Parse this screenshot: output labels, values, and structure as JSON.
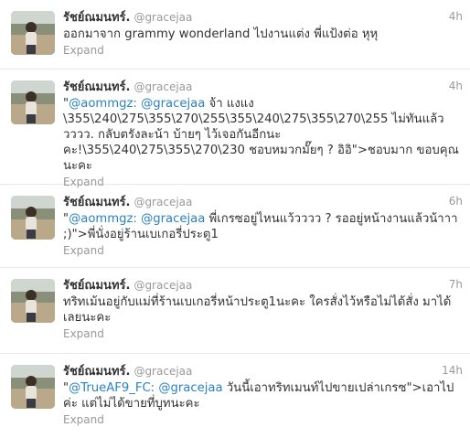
{
  "tweets": [
    {
      "fullname": "รัชย์ณมนทร์.",
      "username": "@gracejaa",
      "time": "4h",
      "mention_1": "",
      "mention_2": "",
      "text": "ออกมาจาก grammy wonderland ไปงานแต่ง พี่แป้งต่อ หุหุ",
      "expand": "Expand"
    },
    {
      "fullname": "รัชย์ณมนทร์.",
      "username": "@gracejaa",
      "time": "4h",
      "quote_open": "\"",
      "mention_1": "@aommgz:",
      "mention_2": "@gracejaa",
      "text": " จ้า แงแง \\355\\240\\275\\355\\270\\255\\355\\240\\275\\355\\270\\255 ไม่ทันแล้ววววว. กลับตรังละน้า บ้ายๆ ไว้เจอกันอีกนะคะ!\\355\\240\\275\\355\\270\\230 ชอบหมวกมั๊ยๆ ? อิอิ\">ชอบมาก ขอบคุณนะคะ",
      "expand": "Expand"
    },
    {
      "fullname": "รัชย์ณมนทร์.",
      "username": "@gracejaa",
      "time": "6h",
      "quote_open": "\"",
      "mention_1": "@aommgz:",
      "mention_2": "@gracejaa",
      "text": " พี่เกรซอยู่ไหนแว้วววว ? รออยู่หน้างานแล้วน้าาา ;)\">พี่นั่งอยู่ร้านเบเกอรี่ประตู1",
      "expand": "Expand"
    },
    {
      "fullname": "รัชย์ณมนทร์.",
      "username": "@gracejaa",
      "time": "7h",
      "mention_1": "",
      "mention_2": "",
      "text": "ทริทเม้นอยู่กับแม่ที่ร้านเบเกอรี่หน้าประตู1นะคะ ใครสั่งไว้หรือไม่ได้สั่ง มาได้เลยนะคะ",
      "expand": "Expand"
    },
    {
      "fullname": "รัชย์ณมนทร์.",
      "username": "@gracejaa",
      "time": "14h",
      "quote_open": "\"",
      "mention_1": "@TrueAF9_FC:",
      "mention_2": "@gracejaa",
      "text": " วันนี้เอาทริทเมนท์ไปขายเปล่าเกรซ\">เอาไปค่ะ แต่ไม่ได้ขายที่บูทนะคะ",
      "expand": "Expand"
    }
  ]
}
